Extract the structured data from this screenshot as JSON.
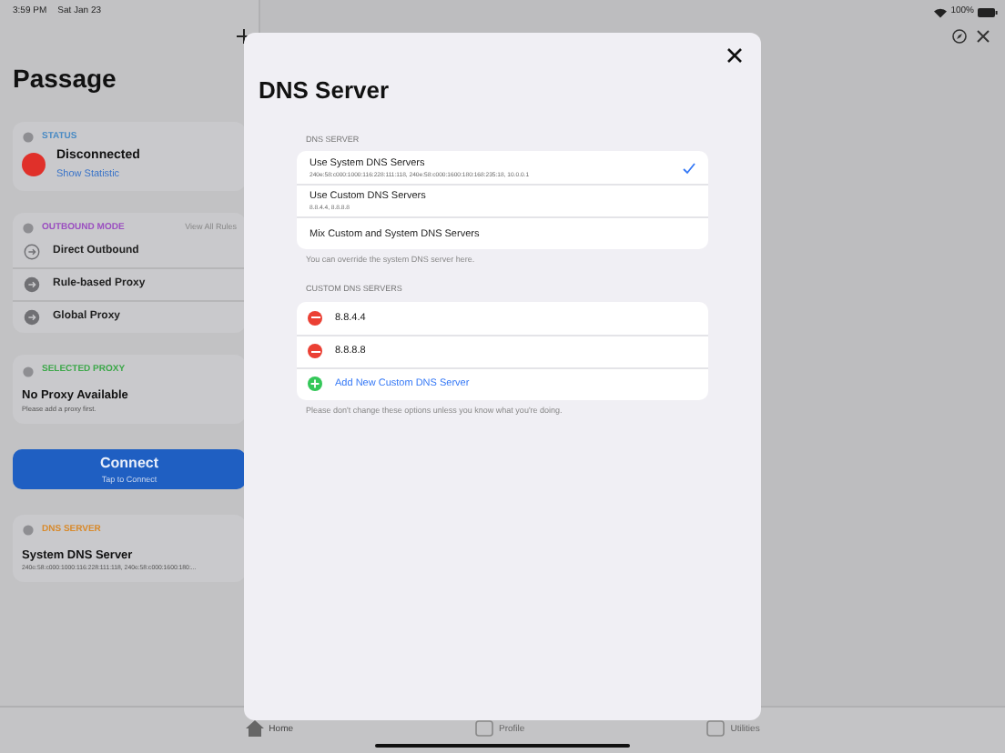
{
  "status_bar": {
    "time": "3:59 PM",
    "date": "Sat Jan 23",
    "battery": "100%"
  },
  "sidebar": {
    "title": "Passage",
    "status": {
      "header": "STATUS",
      "state": "Disconnected",
      "color": "#e0302a",
      "link": "Show Statistic"
    },
    "outbound_mode": {
      "header": "OUTBOUND MODE",
      "action": "View All Rules",
      "items": [
        {
          "label": "Direct Outbound",
          "selected": true
        },
        {
          "label": "Rule-based Proxy",
          "selected": false
        },
        {
          "label": "Global Proxy",
          "selected": false
        }
      ]
    },
    "selected_proxy": {
      "header": "SELECTED PROXY",
      "title": "No Proxy Available",
      "subtitle": "Please add a proxy first."
    },
    "connect": {
      "label": "Connect",
      "sublabel": "Tap to Connect"
    },
    "dns": {
      "header": "DNS SERVER",
      "title": "System DNS Server",
      "subtitle": "240e:58:c000:1000:116:228:111:118, 240e:58:c000:1600:180:..."
    }
  },
  "dialog": {
    "title": "DNS Server",
    "mode_section": {
      "header": "DNS SERVER",
      "footer": "You can override the system DNS server here.",
      "options": [
        {
          "label": "Use System DNS Servers",
          "detail": "240e:58:c000:1000:116:228:111:118, 240e:58:c000:1600:180:168:235:18, 10.0.0.1",
          "selected": true
        },
        {
          "label": "Use Custom DNS Servers",
          "detail": "8.8.4.4, 8.8.8.8",
          "selected": false
        },
        {
          "label": "Mix Custom and System DNS Servers",
          "selected": false
        }
      ]
    },
    "custom_section": {
      "header": "CUSTOM DNS SERVERS",
      "servers": [
        "8.8.4.4",
        "8.8.8.8"
      ],
      "add_label": "Add New Custom DNS Server",
      "footer": "Please don't change these options unless you know what you're doing."
    }
  },
  "tab_bar": [
    {
      "label": "Home",
      "selected": true
    },
    {
      "label": "Profile",
      "selected": false
    },
    {
      "label": "Utilities",
      "selected": false
    }
  ]
}
